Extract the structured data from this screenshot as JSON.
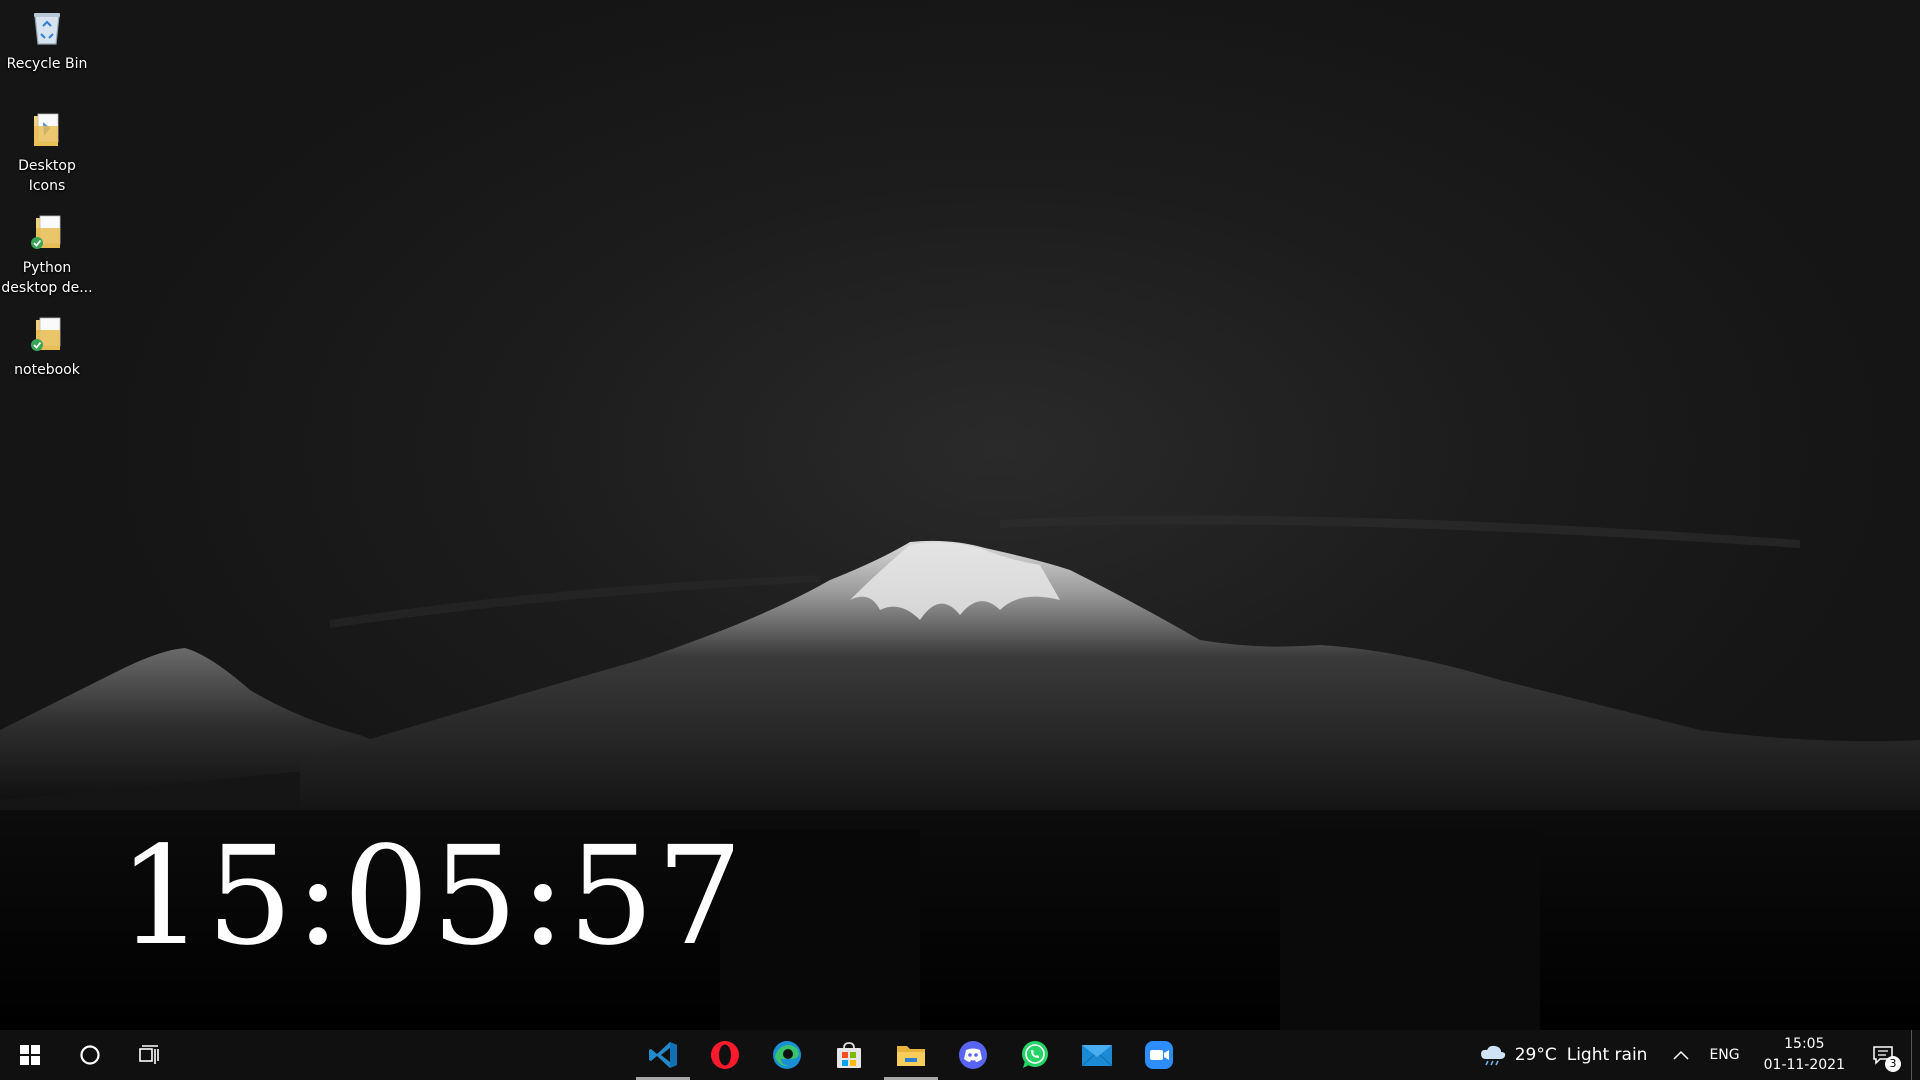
{
  "desktop_icons": [
    {
      "name": "recycle-bin",
      "label": "Recycle Bin",
      "icon": "recycle-bin-icon"
    },
    {
      "name": "desktop-icons-folder",
      "label": "Desktop Icons",
      "icon": "folder-icon"
    },
    {
      "name": "python-folder",
      "label": "Python desktop de...",
      "icon": "folder-synced-icon"
    },
    {
      "name": "notebook-folder",
      "label": "notebook",
      "icon": "folder-synced-icon"
    }
  ],
  "clock_widget": {
    "time": "15:05:57"
  },
  "taskbar": {
    "left": [
      {
        "name": "start-button",
        "icon": "windows-logo-icon"
      },
      {
        "name": "cortana-button",
        "icon": "circle-icon"
      },
      {
        "name": "task-view-button",
        "icon": "task-view-icon"
      }
    ],
    "apps": [
      {
        "name": "vscode",
        "icon": "vscode-icon",
        "running": true
      },
      {
        "name": "opera",
        "icon": "opera-icon",
        "running": false
      },
      {
        "name": "edge",
        "icon": "edge-icon",
        "running": false
      },
      {
        "name": "store",
        "icon": "store-icon",
        "running": false
      },
      {
        "name": "file-explorer",
        "icon": "folder-icon",
        "running": true
      },
      {
        "name": "discord",
        "icon": "discord-icon",
        "running": false
      },
      {
        "name": "whatsapp",
        "icon": "whatsapp-icon",
        "running": false
      },
      {
        "name": "mail",
        "icon": "mail-icon",
        "running": false
      },
      {
        "name": "zoom",
        "icon": "zoom-icon",
        "running": false
      }
    ],
    "tray": {
      "weather_temp": "29°C",
      "weather_condition": "Light rain",
      "weather_icon": "cloud-rain-icon",
      "language": "ENG",
      "time": "15:05",
      "date": "01-11-2021",
      "notification_count": "3"
    }
  },
  "colors": {
    "taskbar_bg": "#101010",
    "running_indicator": "#a8a8a8",
    "clock_text": "#ffffff"
  }
}
